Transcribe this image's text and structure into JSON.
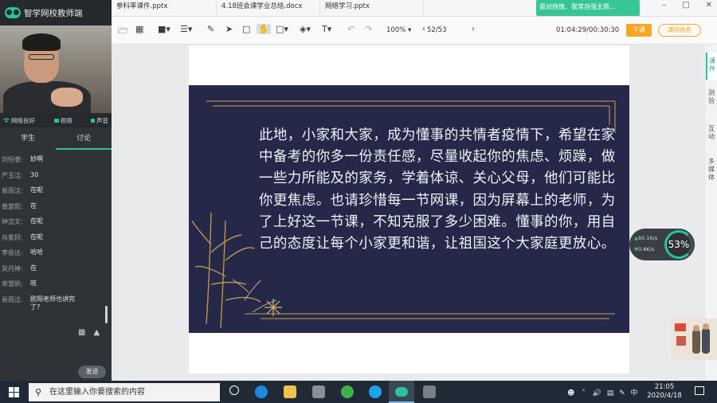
{
  "app": {
    "name": "智学网校教师端"
  },
  "status": {
    "network": "网络良好",
    "video": "视频",
    "audio": "声音"
  },
  "side_tabs": {
    "students": "学生",
    "discussion": "讨论"
  },
  "chat": [
    {
      "name": "刘恒睿:",
      "text": "妙啊"
    },
    {
      "name": "严玉洁:",
      "text": "30"
    },
    {
      "name": "易雨洁:",
      "text": "在呢"
    },
    {
      "name": "黄楚熙:",
      "text": "在"
    },
    {
      "name": "钟浩文:",
      "text": "在呢"
    },
    {
      "name": "肖紫珂:",
      "text": "在呢"
    },
    {
      "name": "李俊达:",
      "text": "哈哈"
    },
    {
      "name": "吴丹婷:",
      "text": "在"
    },
    {
      "name": "宋慧帆:",
      "text": "吱"
    },
    {
      "name": "易雨洁:",
      "text": "欧阳老师也讲完了?"
    }
  ],
  "send_label": "发送",
  "files": [
    "参科率课件.pptx",
    "4.18班会课学业总结.docx",
    "网络学习.pptx"
  ],
  "notice": "面对拖情、我常自强主题...",
  "toolbar": {
    "zoom": "100%",
    "page": "52/53",
    "timer": "01:04:29/00:30:30",
    "end_btn": "下课",
    "rest_btn": "课间休息"
  },
  "slide": {
    "text": "此地，小家和大家，成为懂事的共情者疫情下，希望在家中备考的你多一份责任感，尽量收起你的焦虑、烦躁，做一些力所能及的家务，学着体谅、关心父母，他们可能比你更焦虑。也请珍惜每一节网课，因为屏幕上的老师，为了上好这一节课，不知克服了多少困难。懂事的你，用自己的态度让每个小家更和谐，让祖国这个大家庭更放心。"
  },
  "right_tabs": [
    "课件",
    "测验",
    "互动",
    "多媒体"
  ],
  "net": {
    "up": "60.1",
    "down": "0.8",
    "unit": "K/s",
    "percent": "53%"
  },
  "taskbar": {
    "search_placeholder": "在这里输入你要搜索的内容",
    "time": "21:05",
    "date": "2020/4/18",
    "ime": "中"
  },
  "colors": {
    "accent": "#28c49a",
    "orange": "#f5a623",
    "slide_bg": "#26284a",
    "gold": "#c9a24a"
  }
}
